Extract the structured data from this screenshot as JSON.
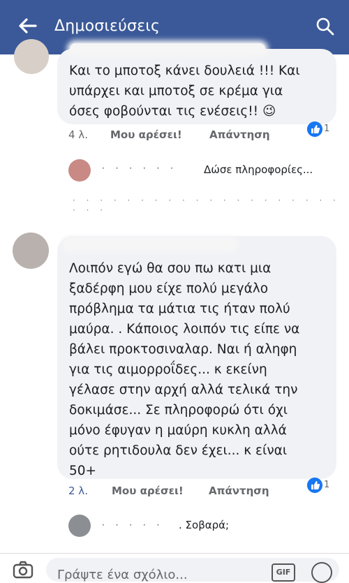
{
  "header": {
    "title": "Δημοσιεύσεις"
  },
  "comments": [
    {
      "text": "Και το μποτοξ κάνει δουλειά !!! Και\nυπάρχει και μποτοξ σε κρέμα για\nόσες φοβούνται τις ενέσεις!! 😉",
      "time": "4 λ.",
      "like_label": "Μου αρέσει!",
      "reply_label": "Απάντηση",
      "reaction_count": "1",
      "replies": [
        {
          "text": "Δώσε πληροφορίες..."
        }
      ]
    },
    {
      "text": "Λοιπόν εγώ θα σου πω κατι μια\nξαδέρφη μου είχε πολύ μεγάλο\nπρόβλημα τα μάτια τις ήταν πολύ\nμαύρα. . Κάποιος λοιπόν τις είπε να\nβάλει προκτοσιναλαρ. Ναι ή αληφη\nγια τις αιμορροΐδες... κ εκείνη\nγέλασε στην αρχή αλλά τελικά την\nδοκιμάσε... Σε πληροφορώ ότι όχι\nμόνο έφυγαν η μαύρη κυκλη αλλά\nούτε ρητιδουλα δεν έχει... κ είναι\n50+",
      "time": "2 λ.",
      "like_label": "Μου αρέσει!",
      "reply_label": "Απάντηση",
      "reaction_count": "1",
      "replies": [
        {
          "text": ". Σοβαρά;"
        }
      ]
    }
  ],
  "composer": {
    "placeholder": "Γράψτε ένα σχόλιο...",
    "gif_label": "GIF"
  },
  "icons": {
    "back": "arrow-left-icon",
    "search": "search-icon",
    "camera": "camera-icon",
    "emoji": "emoji-icon",
    "like_reaction": "like-reaction-icon"
  },
  "colors": {
    "appbar": "#3b5998",
    "reaction": "#1877f2",
    "bubble": "#f0f2f5"
  }
}
